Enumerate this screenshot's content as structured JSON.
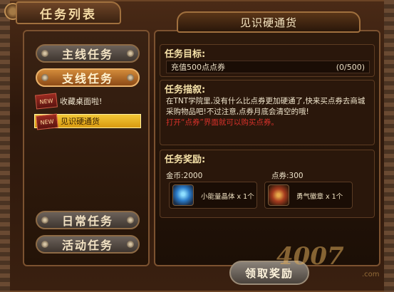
{
  "header": {
    "title": "任务列表"
  },
  "left": {
    "tabs": [
      {
        "label": "主线任务",
        "active": false
      },
      {
        "label": "支线任务",
        "active": true
      }
    ],
    "quests": [
      {
        "label": "收藏桌面啦!",
        "selected": false
      },
      {
        "label": "见识硬通货",
        "selected": true
      }
    ],
    "bottom_tabs": [
      {
        "label": "日常任务"
      },
      {
        "label": "活动任务"
      }
    ]
  },
  "detail": {
    "title": "见识硬通货",
    "goal_title": "任务目标:",
    "goal_text": "充值500点点券",
    "goal_progress": "(0/500)",
    "desc_title": "任务描叙:",
    "desc_text": "在TNT学院里,没有什么比点券更加硬通了,快来买点券去商城采购物品吧!不过注意,点券月底会清空的哦!",
    "desc_hint": "打开“点券”界面就可以购买点券。",
    "reward_title": "任务奖励:",
    "gold_label": "金币:2000",
    "coupon_label": "点券:300",
    "rewards": [
      {
        "name": "小能量晶体 x 1个",
        "icon": "crystal-icon"
      },
      {
        "name": "勇气徽章 x 1个",
        "icon": "medal-icon"
      }
    ],
    "claim_label": "领取奖励"
  },
  "watermark": {
    "text": "4007",
    "domain": ".com"
  }
}
